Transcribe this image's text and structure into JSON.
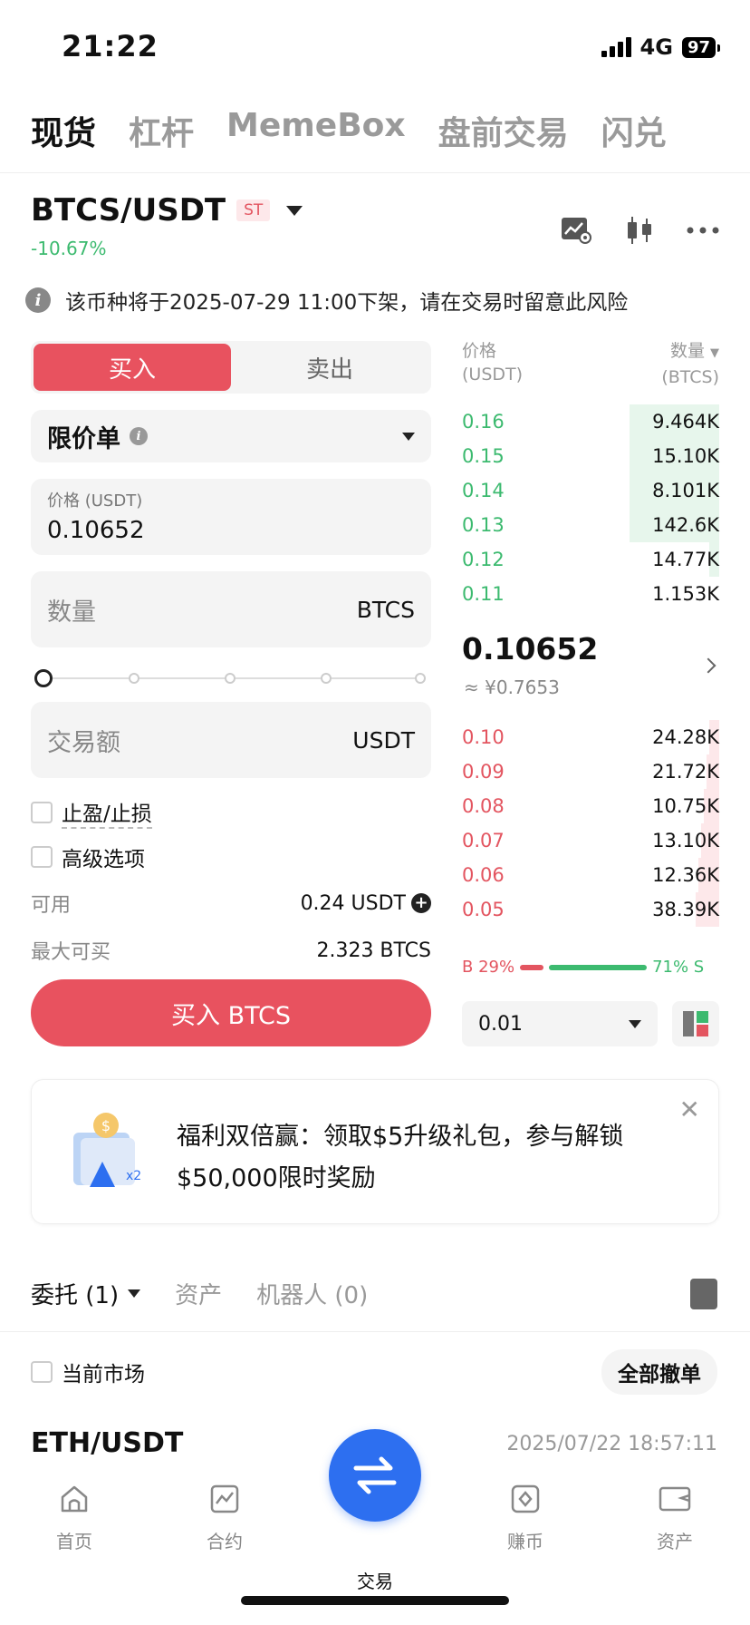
{
  "status_bar": {
    "time": "21:22",
    "network": "4G",
    "battery": "97"
  },
  "top_tabs": [
    "现货",
    "杠杆",
    "MemeBox",
    "盘前交易",
    "闪兑"
  ],
  "pair": {
    "name": "BTCS/USDT",
    "badge": "ST",
    "change": "-10.67%"
  },
  "notice": "该币种将于2025-07-29 11:00下架，请在交易时留意此风险",
  "order_form": {
    "buy_label": "买入",
    "sell_label": "卖出",
    "order_type": "限价单",
    "price_label": "价格 (USDT)",
    "price_value": "0.10652",
    "qty_label": "数量",
    "qty_unit": "BTCS",
    "slider_percent": 0,
    "amount_label": "交易额",
    "amount_unit": "USDT",
    "tp_sl_label": "止盈/止损",
    "advanced_label": "高级选项",
    "available_label": "可用",
    "available_value": "0.24 USDT",
    "max_buy_label": "最大可买",
    "max_buy_value": "2.323 BTCS",
    "submit_label": "买入 BTCS"
  },
  "orderbook": {
    "price_header": "价格",
    "price_unit": "(USDT)",
    "qty_header": "数量",
    "qty_unit": "(BTCS)",
    "asks": [
      {
        "price": "0.16",
        "qty": "9.464K",
        "depth": 0.35
      },
      {
        "price": "0.15",
        "qty": "15.10K",
        "depth": 0.35
      },
      {
        "price": "0.14",
        "qty": "8.101K",
        "depth": 0.35
      },
      {
        "price": "0.13",
        "qty": "142.6K",
        "depth": 0.35
      },
      {
        "price": "0.12",
        "qty": "14.77K",
        "depth": 0.04
      },
      {
        "price": "0.11",
        "qty": "1.153K",
        "depth": 0.0
      }
    ],
    "mid_price": "0.10652",
    "mid_cny": "≈ ¥0.7653",
    "bids": [
      {
        "price": "0.10",
        "qty": "24.28K",
        "depth": 0.04
      },
      {
        "price": "0.09",
        "qty": "21.72K",
        "depth": 0.05
      },
      {
        "price": "0.08",
        "qty": "10.75K",
        "depth": 0.06
      },
      {
        "price": "0.07",
        "qty": "13.10K",
        "depth": 0.07
      },
      {
        "price": "0.06",
        "qty": "12.36K",
        "depth": 0.08
      },
      {
        "price": "0.05",
        "qty": "38.39K",
        "depth": 0.09
      }
    ],
    "buy_ratio": "B 29%",
    "sell_ratio": "71% S",
    "buy_percent": 29,
    "precision": "0.01"
  },
  "promo": {
    "text": "福利双倍赢：领取$5升级礼包，参与解锁$50,000限时奖励"
  },
  "orders_tabs": {
    "orders": "委托 (1)",
    "assets": "资产",
    "bots": "机器人 (0)"
  },
  "current_market_label": "当前市场",
  "cancel_all_label": "全部撤单",
  "order_item": {
    "pair": "ETH/USDT",
    "time": "2025/07/22 18:57:11"
  },
  "bottom_nav": [
    "首页",
    "合约",
    "交易",
    "赚币",
    "资产"
  ],
  "colors": {
    "buy": "#e8525f",
    "sell_green": "#3cba6f",
    "accent": "#2d6ff0"
  }
}
